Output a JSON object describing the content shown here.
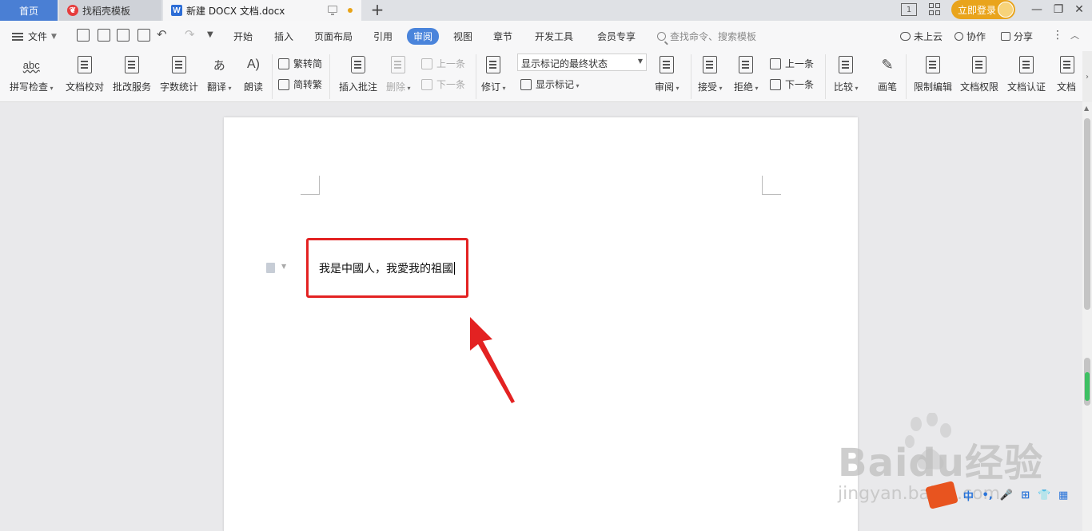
{
  "tabs": {
    "home": "首页",
    "template": "找稻壳模板",
    "document": "新建 DOCX 文档.docx",
    "add": "+"
  },
  "titlebar": {
    "layout_label": "1",
    "login": "立即登录",
    "minimize": "—",
    "restore": "❐",
    "close": "✕"
  },
  "menu": {
    "file": "文件",
    "tabs": [
      "开始",
      "插入",
      "页面布局",
      "引用",
      "审阅",
      "视图",
      "章节",
      "开发工具",
      "会员专享"
    ],
    "active_tab": "审阅",
    "search_placeholder": "查找命令、搜索模板",
    "cloud": "未上云",
    "collaborate": "协作",
    "share": "分享"
  },
  "ribbon": {
    "spell_check": "拼写检查",
    "doc_proof": "文档校对",
    "revise_service": "批改服务",
    "word_count": "字数统计",
    "translate": "翻译",
    "read_aloud": "朗读",
    "trad_to_simp": "繁转简",
    "simp_to_trad": "简转繁",
    "insert_comment": "插入批注",
    "delete": "删除",
    "prev_comment": "上一条",
    "next_comment": "下一条",
    "track_changes": "修订",
    "markup_state": "显示标记的最终状态",
    "show_markup": "显示标记",
    "review": "审阅",
    "accept": "接受",
    "reject": "拒绝",
    "prev_change": "上一条",
    "next_change": "下一条",
    "compare": "比较",
    "pen": "画笔",
    "restrict_edit": "限制编辑",
    "doc_permission": "文档权限",
    "doc_certify": "文档认证",
    "doc_more": "文档"
  },
  "document": {
    "text": "我是中國人，我愛我的祖國"
  },
  "watermark": {
    "main": "Baidu经验",
    "sub": "jingyan.baidu.com"
  },
  "ime": {
    "items": [
      "中",
      "•,",
      "🎤",
      "⊞",
      "👕",
      "▦"
    ]
  },
  "colors": {
    "accent": "#4a84db",
    "highlight": "#e32222",
    "login": "#e9a41c"
  }
}
